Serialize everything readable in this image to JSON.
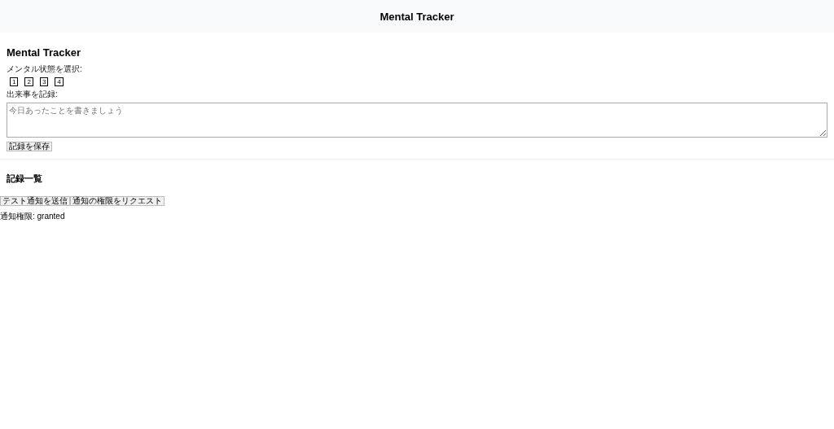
{
  "header": {
    "title": "Mental Tracker"
  },
  "form": {
    "title": "Mental Tracker",
    "mood_label": "メンタル状態を選択:",
    "mood_options": [
      "1",
      "2",
      "3",
      "4"
    ],
    "event_label": "出来事を記録:",
    "event_field": {
      "placeholder": "今日あったことを書きましょう"
    },
    "save_button": "記録を保存"
  },
  "records": {
    "title": "記録一覧"
  },
  "notification": {
    "buttons": [
      "テスト通知を送信",
      "通知の権限をリクエスト"
    ],
    "permission_text": "通知権限: granted"
  }
}
